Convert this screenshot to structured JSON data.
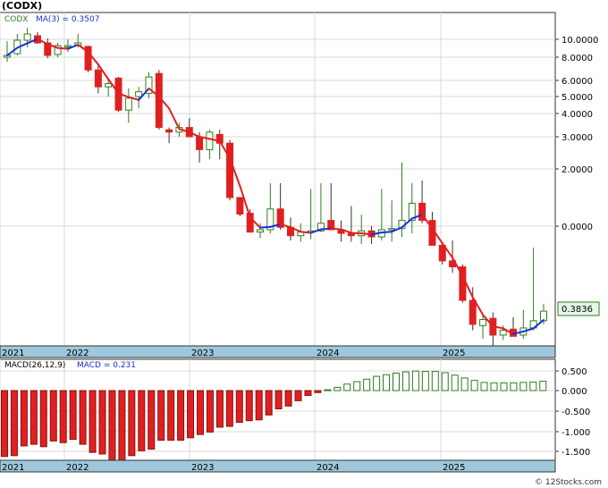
{
  "title": "(CODX)",
  "watermark": "© 12Stocks.com",
  "colors": {
    "up": "#2e7d1e",
    "down": "#e02020",
    "ma_up": "#1a2fd6",
    "ma_down": "#e02020",
    "axis_band": "#9dc8dc",
    "grid": "#d9d9d9",
    "macd_pos": "#2e7d1e",
    "macd_neg": "#e02020",
    "price_badge_bg": "#e6f7e6"
  },
  "chart_data": [
    {
      "type": "candlestick",
      "panel": "price",
      "ticker_label": "CODX",
      "ma_label": "MA(3) = 0.3507",
      "ma_label_name": "MA(3)",
      "ma_label_value": "0.3507",
      "last_price_label": "0.3836",
      "x_tick_labels": [
        "2021",
        "2022",
        "2023",
        "2024",
        "2025"
      ],
      "y_tick_labels": [
        "10.0000",
        "8.0000",
        "6.0000",
        "5.0000",
        "4.0000",
        "3.0000",
        "2.0000",
        "0.0000"
      ],
      "scale": "log",
      "grid": true,
      "candles": [
        {
          "o": 8.0,
          "h": 9.8,
          "l": 7.6,
          "c": 8.2
        },
        {
          "o": 8.4,
          "h": 10.6,
          "l": 8.2,
          "c": 9.9
        },
        {
          "o": 9.9,
          "h": 11.3,
          "l": 9.1,
          "c": 10.6
        },
        {
          "o": 10.4,
          "h": 10.8,
          "l": 9.5,
          "c": 9.6
        },
        {
          "o": 9.6,
          "h": 10.1,
          "l": 7.9,
          "c": 8.2
        },
        {
          "o": 8.3,
          "h": 9.6,
          "l": 8.0,
          "c": 9.3
        },
        {
          "o": 9.2,
          "h": 10.0,
          "l": 8.6,
          "c": 9.3
        },
        {
          "o": 9.3,
          "h": 10.6,
          "l": 9.1,
          "c": 9.6
        },
        {
          "o": 9.2,
          "h": 9.3,
          "l": 6.7,
          "c": 6.9
        },
        {
          "o": 6.9,
          "h": 7.4,
          "l": 5.2,
          "c": 5.6
        },
        {
          "o": 5.6,
          "h": 6.2,
          "l": 5.0,
          "c": 5.8
        },
        {
          "o": 6.2,
          "h": 6.3,
          "l": 4.1,
          "c": 4.2
        },
        {
          "o": 4.2,
          "h": 5.5,
          "l": 3.6,
          "c": 4.9
        },
        {
          "o": 5.0,
          "h": 5.6,
          "l": 4.3,
          "c": 5.3
        },
        {
          "o": 5.2,
          "h": 6.7,
          "l": 4.9,
          "c": 6.3
        },
        {
          "o": 6.6,
          "h": 6.9,
          "l": 3.3,
          "c": 3.4
        },
        {
          "o": 3.3,
          "h": 3.4,
          "l": 2.8,
          "c": 3.2
        },
        {
          "o": 3.2,
          "h": 3.6,
          "l": 3.0,
          "c": 3.4
        },
        {
          "o": 3.4,
          "h": 3.8,
          "l": 3.1,
          "c": 3.0
        },
        {
          "o": 3.0,
          "h": 3.2,
          "l": 2.2,
          "c": 2.6
        },
        {
          "o": 2.6,
          "h": 3.3,
          "l": 2.3,
          "c": 3.2
        },
        {
          "o": 3.1,
          "h": 3.3,
          "l": 2.3,
          "c": 2.8
        },
        {
          "o": 2.8,
          "h": 2.9,
          "l": 0.9,
          "c": 1.0
        },
        {
          "o": 1.0,
          "h": 1.0,
          "l": 0.35,
          "c": 0.42
        },
        {
          "o": 0.45,
          "h": 0.6,
          "l": 0.0,
          "c": -0.5
        },
        {
          "o": -0.5,
          "h": 0.1,
          "l": -1.0,
          "c": -0.3
        },
        {
          "o": -0.3,
          "h": 1.5,
          "l": -0.6,
          "c": 0.6
        },
        {
          "o": 0.6,
          "h": 1.5,
          "l": -0.3,
          "c": -0.1
        },
        {
          "o": -0.1,
          "h": 0.3,
          "l": -1.2,
          "c": -0.8
        },
        {
          "o": -0.8,
          "h": 0.1,
          "l": -1.3,
          "c": -0.5
        },
        {
          "o": -0.5,
          "h": 1.3,
          "l": -1.1,
          "c": -0.4
        },
        {
          "o": -0.4,
          "h": 1.5,
          "l": -0.5,
          "c": 0.1
        },
        {
          "o": 0.2,
          "h": 1.5,
          "l": -0.3,
          "c": -0.3
        },
        {
          "o": -0.3,
          "h": 0.2,
          "l": -1.3,
          "c": -0.6
        },
        {
          "o": -0.6,
          "h": 0.7,
          "l": -1.3,
          "c": -0.8
        },
        {
          "o": -0.8,
          "h": 0.4,
          "l": -1.5,
          "c": -0.4
        },
        {
          "o": -0.4,
          "h": 0.0,
          "l": -1.5,
          "c": -0.9
        },
        {
          "o": -0.9,
          "h": 1.3,
          "l": -1.2,
          "c": -0.3
        },
        {
          "o": -0.3,
          "h": 0.9,
          "l": -1.3,
          "c": -0.2
        },
        {
          "o": -0.2,
          "h": 2.2,
          "l": -0.9,
          "c": 0.2
        },
        {
          "o": 0.2,
          "h": 1.5,
          "l": -0.6,
          "c": 0.8
        },
        {
          "o": 0.8,
          "h": 1.6,
          "l": 0.1,
          "c": 0.2
        },
        {
          "o": 0.2,
          "h": 0.5,
          "l": -1.4,
          "c": -1.6
        },
        {
          "o": -1.6,
          "h": -1.3,
          "l": -3.2,
          "c": -2.9
        },
        {
          "o": -2.9,
          "h": -1.2,
          "l": -3.9,
          "c": -3.4
        },
        {
          "o": -3.4,
          "h": -3.2,
          "l": -6.4,
          "c": -6.2
        },
        {
          "o": -6.2,
          "h": -5.1,
          "l": -8.7,
          "c": -8.2
        },
        {
          "o": -8.3,
          "h": -7.4,
          "l": -9.4,
          "c": -7.8
        },
        {
          "o": -7.7,
          "h": -7.2,
          "l": -10.3,
          "c": -9.1
        },
        {
          "o": -9.1,
          "h": -8.3,
          "l": -9.5,
          "c": -8.7
        },
        {
          "o": -8.6,
          "h": -7.6,
          "l": -9.2,
          "c": -9.2
        },
        {
          "o": -9.1,
          "h": -7.0,
          "l": -9.4,
          "c": -8.5
        },
        {
          "o": -8.5,
          "h": -1.8,
          "l": -8.7,
          "c": -7.9
        },
        {
          "o": -7.9,
          "h": -6.5,
          "l": -8.2,
          "c": -7.1
        }
      ]
    },
    {
      "type": "bar",
      "panel": "macd",
      "label": "MACD(26,12,9)",
      "value_label": "MACD = 0.231",
      "value_label_name": "MACD",
      "value_label_value": "0.231",
      "x_tick_labels": [
        "2021",
        "2022",
        "2023",
        "2024",
        "2025"
      ],
      "y_tick_labels": [
        "0.500",
        "0.000",
        "-0.500",
        "-1.000",
        "-1.500"
      ],
      "ylim": [
        -1.78,
        0.68
      ],
      "grid": true,
      "values": [
        -1.62,
        -1.6,
        -1.36,
        -1.32,
        -1.38,
        -1.24,
        -1.28,
        -1.2,
        -1.32,
        -1.52,
        -1.56,
        -1.72,
        -1.74,
        -1.6,
        -1.48,
        -1.44,
        -1.22,
        -1.22,
        -1.22,
        -1.16,
        -1.08,
        -1.02,
        -0.9,
        -0.88,
        -0.78,
        -0.74,
        -0.72,
        -0.6,
        -0.45,
        -0.38,
        -0.25,
        -0.12,
        -0.05,
        0.02,
        0.08,
        0.16,
        0.22,
        0.28,
        0.35,
        0.39,
        0.43,
        0.46,
        0.48,
        0.47,
        0.47,
        0.44,
        0.38,
        0.31,
        0.25,
        0.2,
        0.19,
        0.19,
        0.19,
        0.2,
        0.21,
        0.23
      ]
    }
  ]
}
